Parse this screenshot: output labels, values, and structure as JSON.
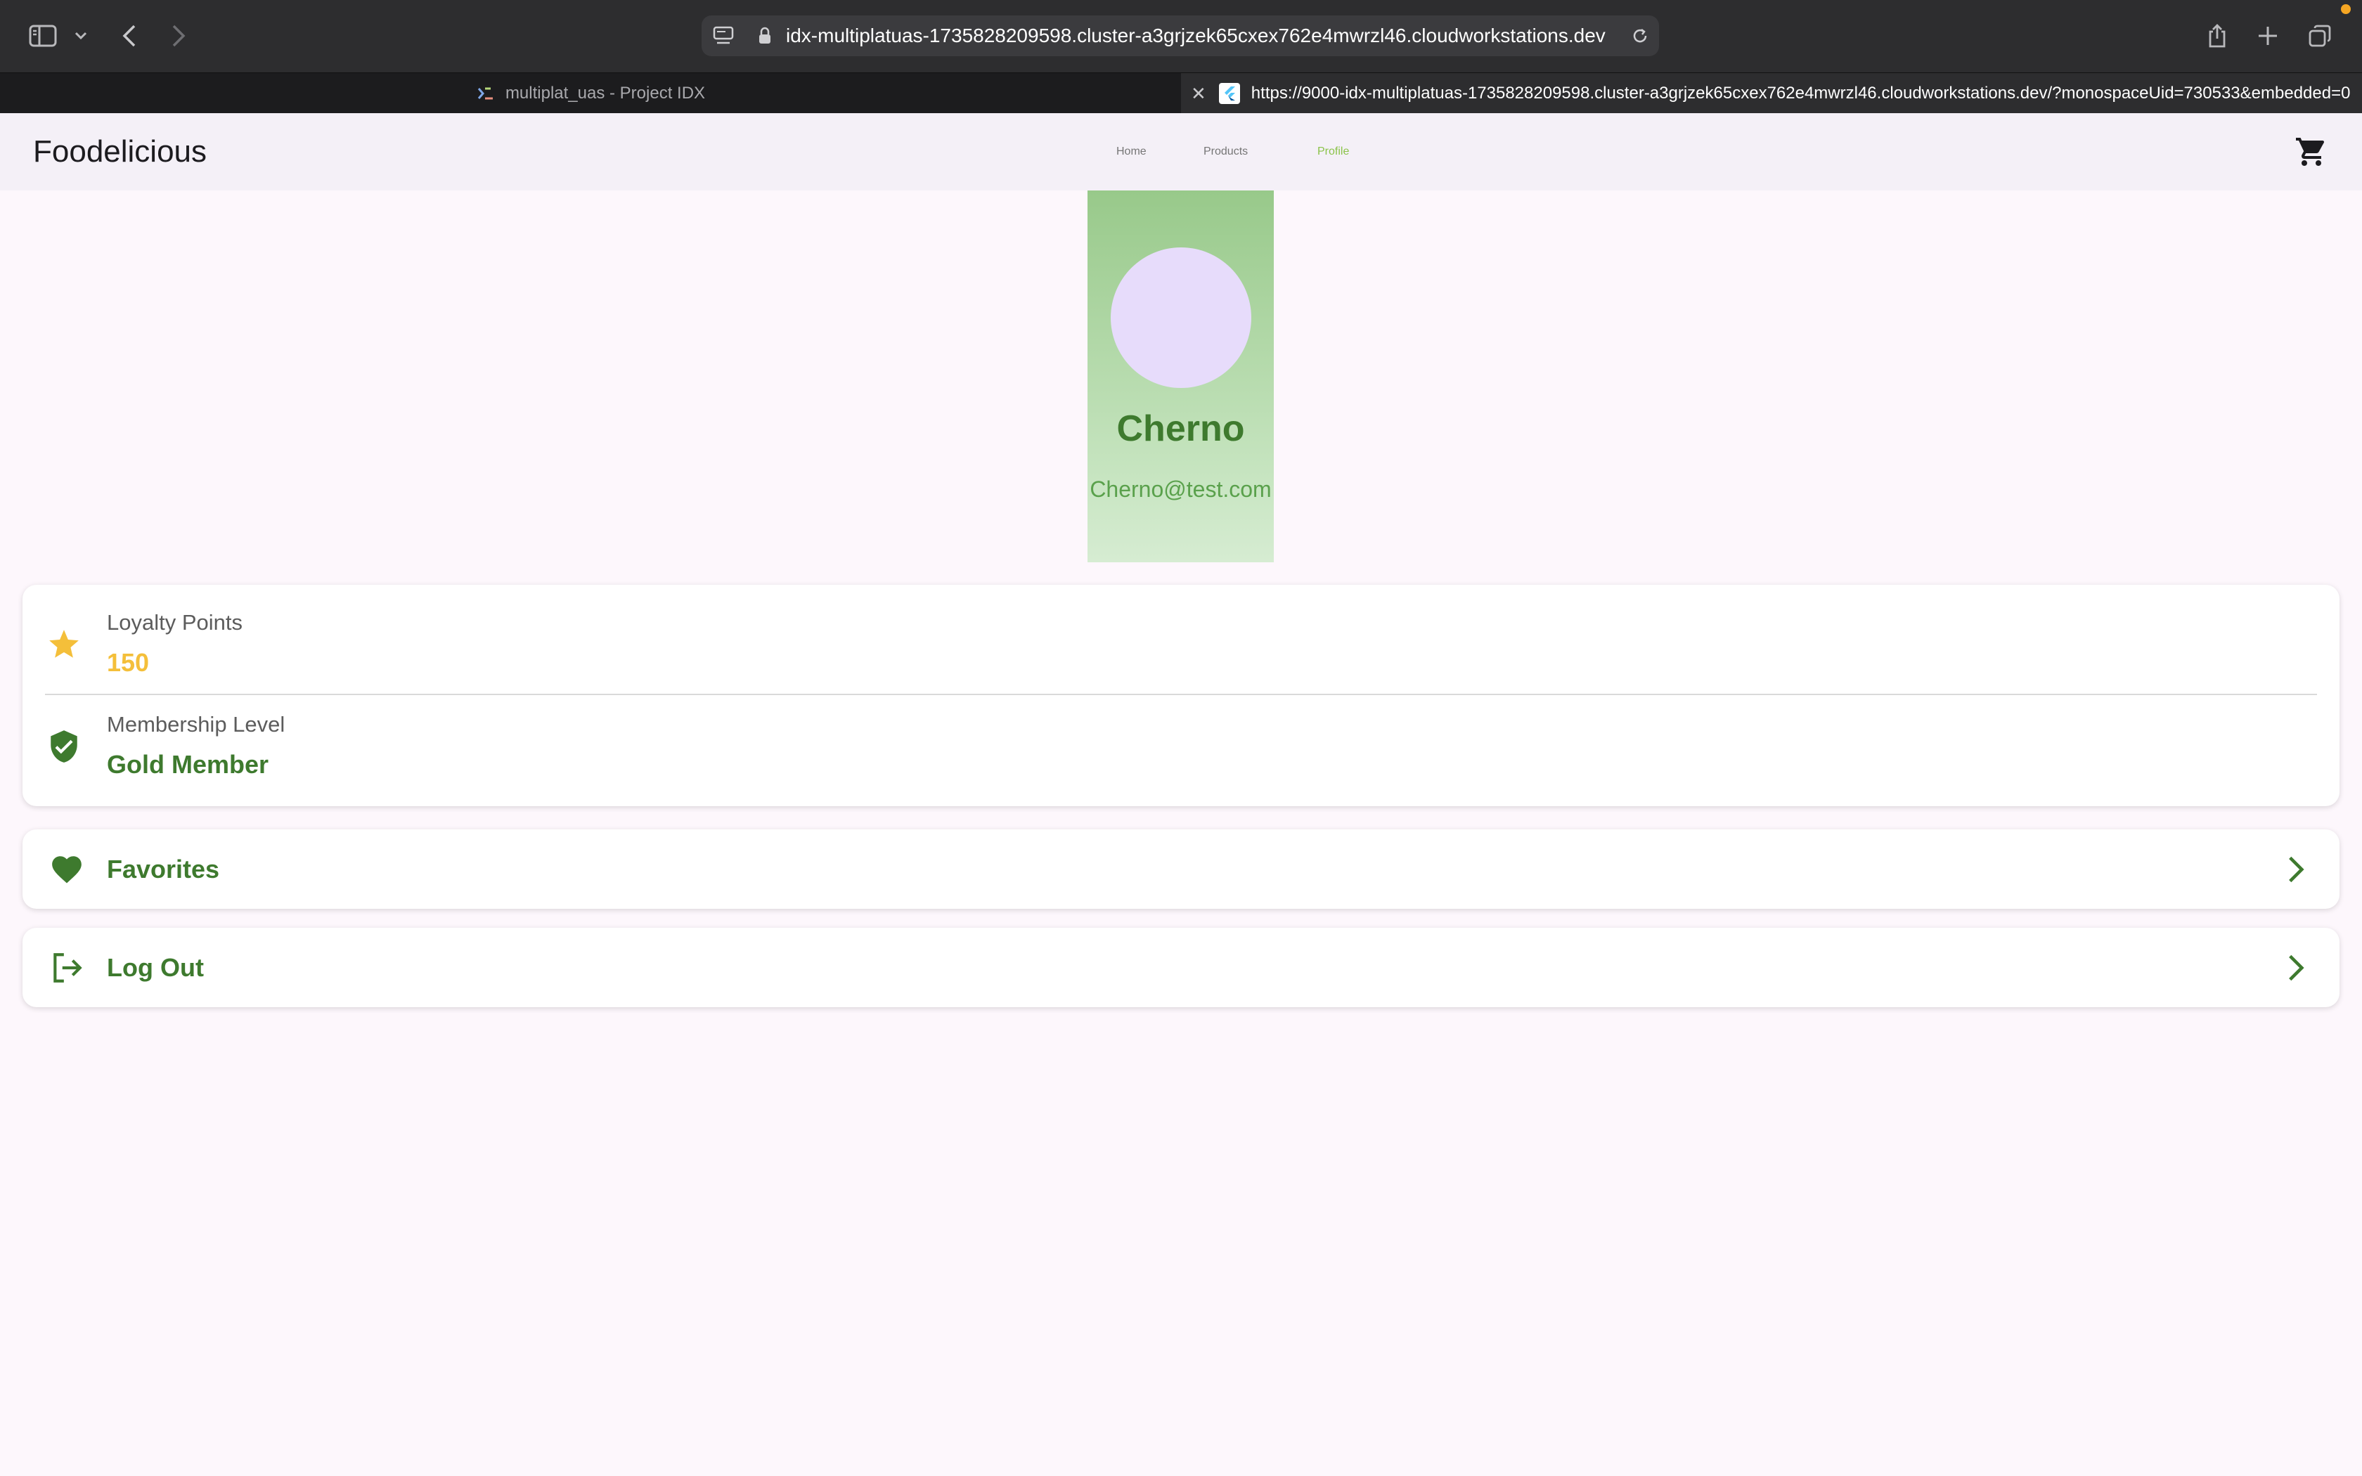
{
  "browser": {
    "url": "idx-multiplatuas-1735828209598.cluster-a3grjzek65cxex762e4mwrzl46.cloudworkstations.dev",
    "tabs": [
      {
        "title": "multiplat_uas - Project IDX"
      },
      {
        "title": "https://9000-idx-multiplatuas-1735828209598.cluster-a3grjzek65cxex762e4mwrzl46.cloudworkstations.dev/?monospaceUid=730533&embedded=0"
      }
    ]
  },
  "app": {
    "brand": "Foodelicious",
    "nav": [
      {
        "label": "Home",
        "active": false
      },
      {
        "label": "Products",
        "active": false
      },
      {
        "label": "Profile",
        "active": true
      }
    ],
    "cart_icon": "shopping-cart-icon"
  },
  "profile": {
    "name": "Cherno",
    "email": "Cherno@test.com"
  },
  "stats": {
    "loyalty": {
      "label": "Loyalty Points",
      "value": "150",
      "icon": "star-icon",
      "color": "#f4bf3a"
    },
    "membership": {
      "label": "Membership Level",
      "value": "Gold Member",
      "icon": "verified-shield-icon",
      "color": "#3e7a2e"
    }
  },
  "menu": {
    "favorites": {
      "label": "Favorites",
      "icon": "heart-icon"
    },
    "logout": {
      "label": "Log Out",
      "icon": "logout-icon"
    }
  },
  "colors": {
    "primary_green": "#3e7a2e",
    "nav_active": "#8bc34a",
    "star_yellow": "#f4bf3a"
  }
}
